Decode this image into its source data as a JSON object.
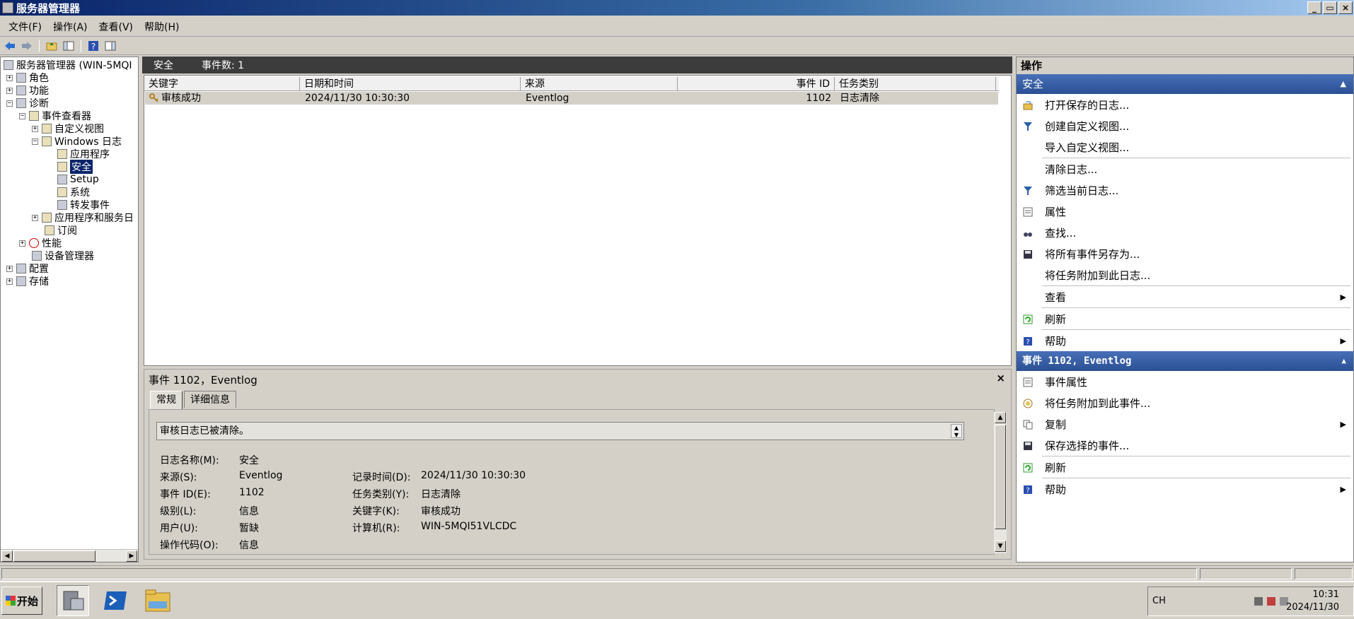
{
  "window": {
    "title": "服务器管理器",
    "buttons": [
      "_",
      "▭",
      "×"
    ]
  },
  "menu": [
    "文件(F)",
    "操作(A)",
    "查看(V)",
    "帮助(H)"
  ],
  "toolbar": {
    "icons": [
      "back-icon",
      "forward-icon",
      "up-folder-icon",
      "show-hide-tree-icon",
      "help-icon",
      "show-hide-action-pane-icon"
    ]
  },
  "tree": {
    "items": [
      {
        "label": "服务器管理器 (WIN-5MQI",
        "icon": "server-icon",
        "exp": ""
      },
      {
        "label": "角色",
        "icon": "roles-icon",
        "exp": "+"
      },
      {
        "label": "功能",
        "icon": "features-icon",
        "exp": "+"
      },
      {
        "label": "诊断",
        "icon": "diagnostics-icon",
        "exp": "−"
      },
      {
        "label": "事件查看器",
        "icon": "event-viewer-icon",
        "exp": "−"
      },
      {
        "label": "自定义视图",
        "icon": "folder-icon",
        "exp": "+"
      },
      {
        "label": "Windows 日志",
        "icon": "folder-icon",
        "exp": "−"
      },
      {
        "label": "应用程序",
        "icon": "log-icon",
        "exp": ""
      },
      {
        "label": "安全",
        "icon": "log-icon",
        "exp": ""
      },
      {
        "label": "Setup",
        "icon": "log-icon",
        "exp": ""
      },
      {
        "label": "系统",
        "icon": "log-icon",
        "exp": ""
      },
      {
        "label": "转发事件",
        "icon": "log-icon",
        "exp": ""
      },
      {
        "label": "应用程序和服务日",
        "icon": "folder-icon",
        "exp": "+"
      },
      {
        "label": "订阅",
        "icon": "subscription-icon",
        "exp": ""
      },
      {
        "label": "性能",
        "icon": "performance-icon",
        "exp": "+"
      },
      {
        "label": "设备管理器",
        "icon": "device-manager-icon",
        "exp": ""
      },
      {
        "label": "配置",
        "icon": "configuration-icon",
        "exp": "+"
      },
      {
        "label": "存储",
        "icon": "storage-icon",
        "exp": "+"
      }
    ]
  },
  "center": {
    "log_name": "安全",
    "event_count": "事件数: 1",
    "columns": [
      "关键字",
      "日期和时间",
      "来源",
      "事件 ID",
      "任务类别"
    ],
    "rows": [
      {
        "keyword": "审核成功",
        "datetime": "2024/11/30 10:30:30",
        "source": "Eventlog",
        "event_id": "1102",
        "task": "日志清除"
      }
    ]
  },
  "preview": {
    "header": "事件 1102，Eventlog",
    "close": "×",
    "tabs": [
      "常规",
      "详细信息"
    ],
    "message": "审核日志已被清除。",
    "fields": {
      "log_name_label": "日志名称(M):",
      "log_name": "安全",
      "source_label": "来源(S):",
      "source": "Eventlog",
      "logged_label": "记录时间(D):",
      "logged": "2024/11/30 10:30:30",
      "event_id_label": "事件 ID(E):",
      "event_id": "1102",
      "task_label": "任务类别(Y):",
      "task": "日志清除",
      "level_label": "级别(L):",
      "level": "信息",
      "keywords_label": "关键字(K):",
      "keywords": "审核成功",
      "user_label": "用户(U):",
      "user": "暂缺",
      "computer_label": "计算机(R):",
      "computer": "WIN-5MQI51VLCDC",
      "opcode_label": "操作代码(O):",
      "opcode": "信息"
    }
  },
  "actions": {
    "title": "操作",
    "section1": {
      "title": "安全",
      "items": [
        {
          "label": "打开保存的日志...",
          "icon": "open-log-icon",
          "arrow": false,
          "div": false
        },
        {
          "label": "创建自定义视图...",
          "icon": "filter-icon",
          "arrow": false,
          "div": false
        },
        {
          "label": "导入自定义视图...",
          "icon": "",
          "arrow": false,
          "div": true
        },
        {
          "label": "清除日志...",
          "icon": "",
          "arrow": false,
          "div": false
        },
        {
          "label": "筛选当前日志...",
          "icon": "filter-icon",
          "arrow": false,
          "div": false
        },
        {
          "label": "属性",
          "icon": "properties-icon",
          "arrow": false,
          "div": false
        },
        {
          "label": "查找...",
          "icon": "binoculars-icon",
          "arrow": false,
          "div": false
        },
        {
          "label": "将所有事件另存为...",
          "icon": "save-icon",
          "arrow": false,
          "div": false
        },
        {
          "label": "将任务附加到此日志...",
          "icon": "",
          "arrow": false,
          "div": true
        },
        {
          "label": "查看",
          "icon": "",
          "arrow": true,
          "div": true
        },
        {
          "label": "刷新",
          "icon": "refresh-icon",
          "arrow": false,
          "div": true
        },
        {
          "label": "帮助",
          "icon": "help-icon",
          "arrow": true,
          "div": false
        }
      ]
    },
    "section2": {
      "title": "事件 1102, Eventlog",
      "items": [
        {
          "label": "事件属性",
          "icon": "properties-icon",
          "arrow": false,
          "div": false
        },
        {
          "label": "将任务附加到此事件...",
          "icon": "task-icon",
          "arrow": false,
          "div": false
        },
        {
          "label": "复制",
          "icon": "copy-icon",
          "arrow": true,
          "div": false
        },
        {
          "label": "保存选择的事件...",
          "icon": "save-icon",
          "arrow": false,
          "div": true
        },
        {
          "label": "刷新",
          "icon": "refresh-icon",
          "arrow": false,
          "div": true
        },
        {
          "label": "帮助",
          "icon": "help-icon",
          "arrow": true,
          "div": false
        }
      ]
    }
  },
  "taskbar": {
    "start": "开始",
    "apps": [
      "server-manager-icon",
      "powershell-icon",
      "explorer-icon"
    ],
    "ime": "CH",
    "time": "10:31",
    "date": "2024/11/30"
  },
  "colors": {
    "selection": "#0a246a",
    "section_header": "#2a4f93",
    "list_selected_row": "#d4d0c8"
  }
}
